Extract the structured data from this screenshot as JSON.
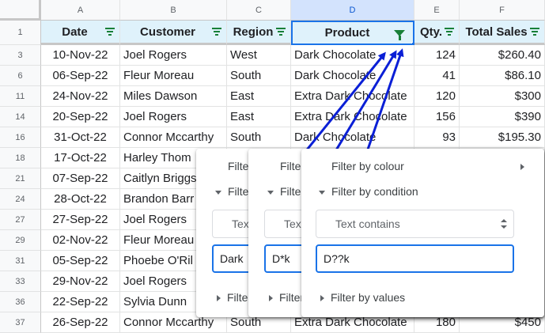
{
  "columns": [
    {
      "letter": "A",
      "header": "Date"
    },
    {
      "letter": "B",
      "header": "Customer"
    },
    {
      "letter": "C",
      "header": "Region"
    },
    {
      "letter": "D",
      "header": "Product"
    },
    {
      "letter": "E",
      "header": "Qty."
    },
    {
      "letter": "F",
      "header": "Total Sales"
    }
  ],
  "header_row_number": "1",
  "rows": [
    {
      "num": "3",
      "date": "10-Nov-22",
      "customer": "Joel Rogers",
      "region": "West",
      "product": "Dark Chocolate",
      "qty": "124",
      "sales": "$260.40"
    },
    {
      "num": "6",
      "date": "06-Sep-22",
      "customer": "Fleur Moreau",
      "region": "South",
      "product": "Dark Chocolate",
      "qty": "41",
      "sales": "$86.10"
    },
    {
      "num": "11",
      "date": "24-Nov-22",
      "customer": "Miles Dawson",
      "region": "East",
      "product": "Extra Dark Chocolate",
      "qty": "120",
      "sales": "$300"
    },
    {
      "num": "14",
      "date": "20-Sep-22",
      "customer": "Joel Rogers",
      "region": "East",
      "product": "Extra Dark Chocolate",
      "qty": "156",
      "sales": "$390"
    },
    {
      "num": "16",
      "date": "31-Oct-22",
      "customer": "Connor Mccarthy",
      "region": "South",
      "product": "Dark Chocolate",
      "qty": "93",
      "sales": "$195.30"
    },
    {
      "num": "18",
      "date": "17-Oct-22",
      "customer": "Harley Thom",
      "region": "",
      "product": "",
      "qty": "",
      "sales": ""
    },
    {
      "num": "21",
      "date": "07-Sep-22",
      "customer": "Caitlyn Briggs",
      "region": "",
      "product": "",
      "qty": "",
      "sales": ""
    },
    {
      "num": "24",
      "date": "28-Oct-22",
      "customer": "Brandon Barr",
      "region": "",
      "product": "",
      "qty": "",
      "sales": ""
    },
    {
      "num": "27",
      "date": "27-Sep-22",
      "customer": "Joel Rogers",
      "region": "",
      "product": "",
      "qty": "",
      "sales": ""
    },
    {
      "num": "29",
      "date": "02-Nov-22",
      "customer": "Fleur Moreau",
      "region": "",
      "product": "",
      "qty": "",
      "sales": ""
    },
    {
      "num": "31",
      "date": "05-Sep-22",
      "customer": "Phoebe O'Ril",
      "region": "",
      "product": "",
      "qty": "",
      "sales": ""
    },
    {
      "num": "33",
      "date": "29-Nov-22",
      "customer": "Joel Rogers",
      "region": "",
      "product": "",
      "qty": "",
      "sales": ""
    },
    {
      "num": "36",
      "date": "22-Sep-22",
      "customer": "Sylvia Dunn",
      "region": "",
      "product": "",
      "qty": "",
      "sales": ""
    },
    {
      "num": "37",
      "date": "26-Sep-22",
      "customer": "Connor Mccarthy",
      "region": "South",
      "product": "Extra Dark Chocolate",
      "qty": "180",
      "sales": "$450"
    }
  ],
  "filter_panels": [
    {
      "filter_by_colour": "Filter by colour",
      "filter_by_condition": "Filter by condition",
      "condition": "Text contains",
      "value": "Dark",
      "filter_by_values": "Filter by values"
    },
    {
      "filter_by_colour": "Filter by colour",
      "filter_by_condition": "Filter by condition",
      "condition": "Text contains",
      "value": "D*k",
      "filter_by_values": "Filter by values"
    },
    {
      "filter_by_colour": "Filter by colour",
      "filter_by_condition": "Filter by condition",
      "condition": "Text contains",
      "value": "D??k",
      "filter_by_values": "Filter by values"
    }
  ],
  "colors": {
    "accent_blue": "#1a73e8",
    "arrow_blue": "#0a1fd6",
    "filter_green": "#188038",
    "header_fill": "#dff2fb"
  }
}
